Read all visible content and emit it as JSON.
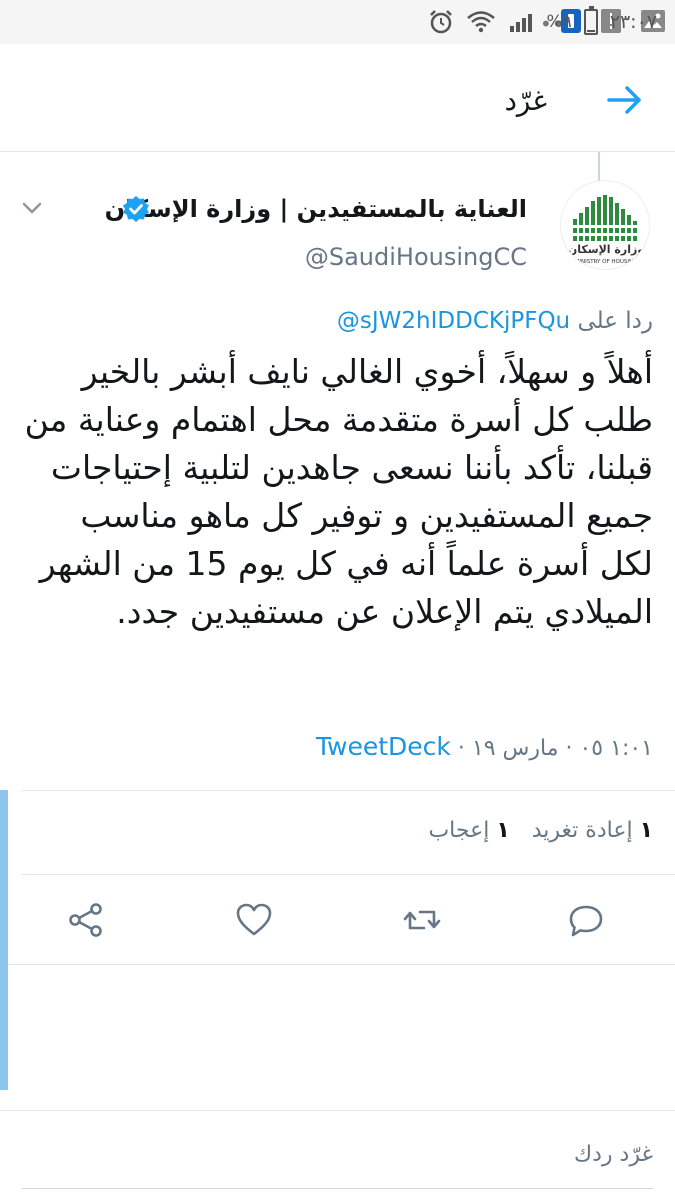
{
  "status_bar": {
    "time": "٢٣:٠٧",
    "battery_percent": "%٩",
    "battery_level": 0.09,
    "icons": [
      "alarm-icon",
      "wifi-icon",
      "signal-icon",
      "battery-icon",
      "overflow-dots-icon",
      "app-icon",
      "alert-icon",
      "image-icon"
    ]
  },
  "header": {
    "title": "غرّد",
    "back_icon": "arrow-right-icon"
  },
  "tweet": {
    "display_name": "العناية بالمستفيدين | وزارة الإسكان",
    "handle": "@SaudiHousingCC",
    "reply_prefix": "ردا على",
    "reply_mention": "@sJW2hIDDCKjPFQu",
    "text": "أهلاً و سهلاً، أخوي الغالي نايف أبشر بالخير طلب كل أسرة متقدمة محل اهتمام وعناية من قبلنا، تأكد بأننا نسعى جاهدين لتلبية إحتياجات جميع المستفيدين و توفير كل ماهو مناسب لكل أسرة علماً أنه في كل يوم 15 من الشهر الميلادي يتم الإعلان عن مستفيدين جدد.",
    "timestamp": "١:٠١ ٠٥ · مارس ١٩ ·",
    "source": "TweetDeck",
    "logo_text": "وزارة الإسكان",
    "logo_subtext": "MINISTRY OF HOUSING"
  },
  "stats": {
    "retweets_count": "١",
    "retweets_label": "إعادة تغريد",
    "likes_count": "١",
    "likes_label": "إعجاب"
  },
  "actions": [
    "reply-icon",
    "retweet-icon",
    "like-icon",
    "share-icon"
  ],
  "compose": {
    "placeholder": "غرّد ردك"
  },
  "colors": {
    "accent": "#1da1f2",
    "link": "#1b95e0",
    "secondary_text": "#657786",
    "divider": "#e1e8ed",
    "logo_green": "#2e8b3d"
  }
}
